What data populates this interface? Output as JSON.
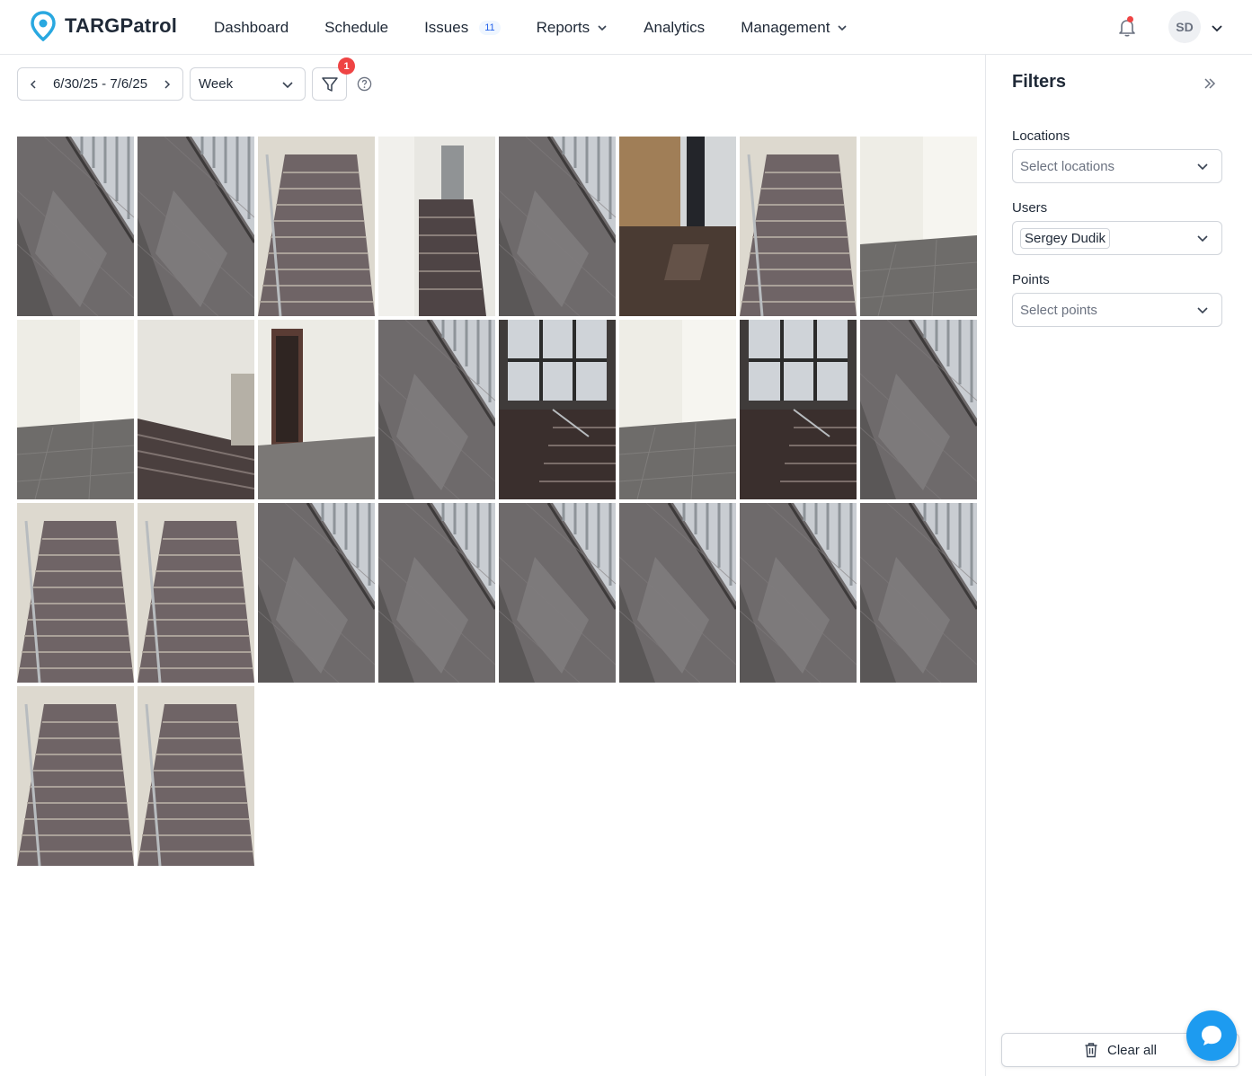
{
  "header": {
    "logo_text": "TARGPatrol",
    "nav": [
      {
        "label": "Dashboard"
      },
      {
        "label": "Schedule"
      },
      {
        "label": "Issues",
        "badge": "11"
      },
      {
        "label": "Reports",
        "dropdown": true
      },
      {
        "label": "Analytics"
      },
      {
        "label": "Management",
        "dropdown": true
      }
    ],
    "avatar_initials": "SD"
  },
  "toolbar": {
    "date_range": "6/30/25 - 7/6/25",
    "period": "Week",
    "filter_count": "1"
  },
  "photos": [
    {
      "scene": "floor-window"
    },
    {
      "scene": "floor-window"
    },
    {
      "scene": "stairs-up"
    },
    {
      "scene": "stairs-landing"
    },
    {
      "scene": "floor-window"
    },
    {
      "scene": "room-dark"
    },
    {
      "scene": "stairs-up"
    },
    {
      "scene": "hall-white"
    },
    {
      "scene": "hall-white"
    },
    {
      "scene": "stairs-down"
    },
    {
      "scene": "room-door"
    },
    {
      "scene": "floor-window"
    },
    {
      "scene": "window-stairs"
    },
    {
      "scene": "hall-white"
    },
    {
      "scene": "window-stairs"
    },
    {
      "scene": "floor-window"
    },
    {
      "scene": "stairs-up"
    },
    {
      "scene": "stairs-up"
    },
    {
      "scene": "floor-window"
    },
    {
      "scene": "floor-window"
    },
    {
      "scene": "floor-window"
    },
    {
      "scene": "floor-window"
    },
    {
      "scene": "floor-window"
    },
    {
      "scene": "floor-window"
    },
    {
      "scene": "stairs-up"
    },
    {
      "scene": "stairs-up"
    }
  ],
  "filters": {
    "title": "Filters",
    "locations_label": "Locations",
    "locations_placeholder": "Select locations",
    "users_label": "Users",
    "users_selected": "Sergey Dudik",
    "points_label": "Points",
    "points_placeholder": "Select points",
    "clear_label": "Clear all"
  },
  "colors": {
    "accent": "#1d9bf0",
    "badge": "#ef4444",
    "logo_pin": "#29a8e0"
  }
}
